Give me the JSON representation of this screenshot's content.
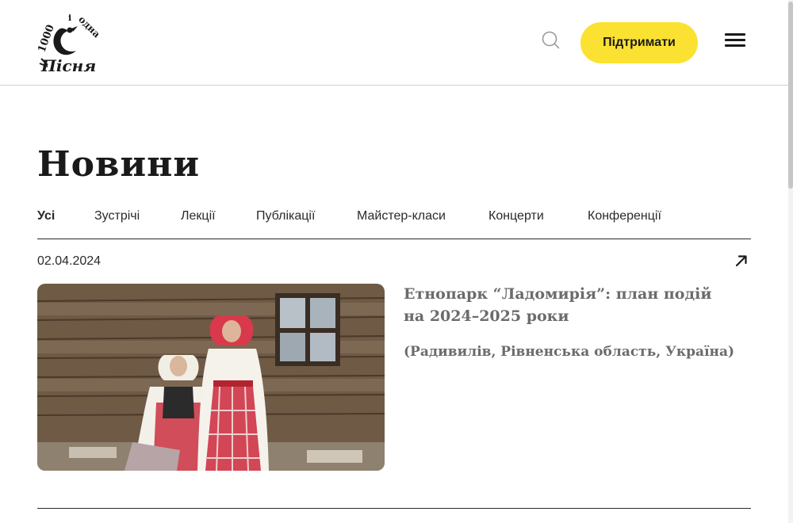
{
  "header": {
    "logo_icon": "thousand-and-one-song-logo",
    "logo_text_top": "1001",
    "logo_text_bottom": "Пісня",
    "search_icon": "search-icon",
    "support_label": "Підтримати",
    "menu_icon": "hamburger-menu-icon"
  },
  "page": {
    "title": "Новини"
  },
  "tabs": [
    {
      "label": "Усі",
      "active": true
    },
    {
      "label": "Зустрічі",
      "active": false
    },
    {
      "label": "Лекції",
      "active": false
    },
    {
      "label": "Публікації",
      "active": false
    },
    {
      "label": "Майстер-класи",
      "active": false
    },
    {
      "label": "Концерти",
      "active": false
    },
    {
      "label": "Конференції",
      "active": false
    }
  ],
  "news": [
    {
      "date": "02.04.2024",
      "title": "Етнопарк “Ладомирія”: план подій на 2024–2025 роки",
      "subtitle": "(Радивилів, Рівненська область, Україна)",
      "image_icon": "photo-two-women-folk-costume",
      "arrow_icon": "arrow-up-right-icon"
    }
  ],
  "colors": {
    "accent": "#fbe232",
    "text": "#1a1a1a",
    "muted_title": "#6b6b6b",
    "divider": "#2a2a2a"
  }
}
